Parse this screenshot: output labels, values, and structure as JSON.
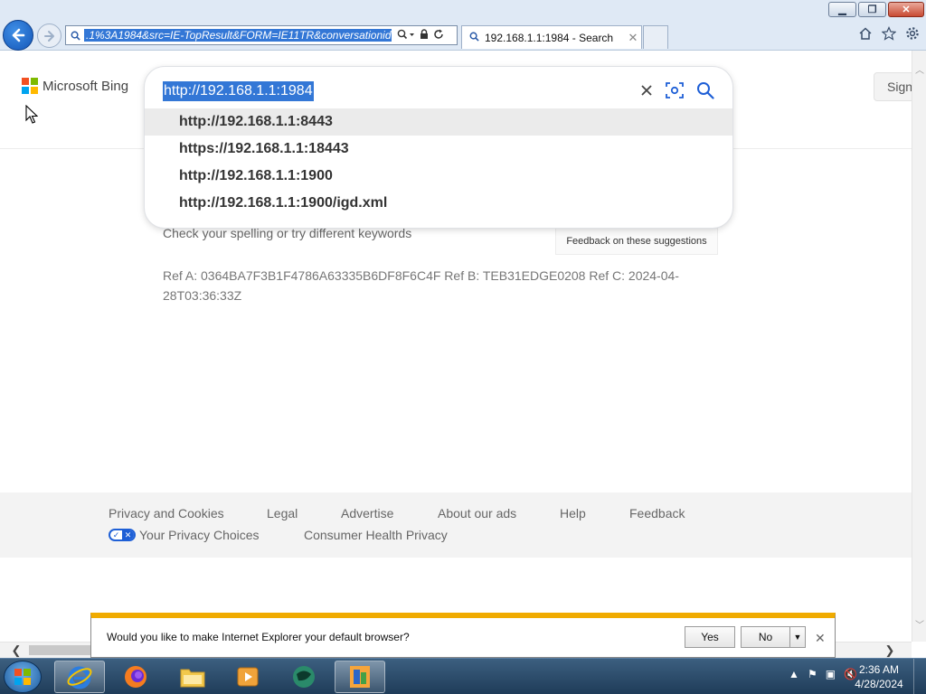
{
  "browser": {
    "address_url": ".1%3A1984&src=IE-TopResult&FORM=IE11TR&conversationid=",
    "tab_title": "192.168.1.1:1984 - Search"
  },
  "bing": {
    "logo_text": "Microsoft Bing",
    "signin_label": "Sign",
    "query": "http://192.168.1.1:1984",
    "suggestions": [
      "http://192.168.1.1:8443",
      "https://192.168.1.1:18443",
      "http://192.168.1.1:1900",
      "http://192.168.1.1:1900/igd.xml"
    ],
    "spell_tip": "Check your spelling or try different keywords",
    "feedback_suggestions": "Feedback on these suggestions",
    "ref_line": "Ref A: 0364BA7F3B1F4786A63335B6DF8F6C4F Ref B: TEB31EDGE0208 Ref C: 2024-04-28T03:36:33Z"
  },
  "footer": {
    "links": [
      "Privacy and Cookies",
      "Legal",
      "Advertise",
      "About our ads",
      "Help",
      "Feedback"
    ],
    "privacy_choices": "Your Privacy Choices",
    "consumer_health": "Consumer Health Privacy"
  },
  "notification": {
    "message": "Would you like to make Internet Explorer your default browser?",
    "yes_label": "Yes",
    "no_label": "No"
  },
  "taskbar": {
    "time": "2:36 AM",
    "date": "4/28/2024"
  },
  "colors": {
    "selection": "#3377d6",
    "notify_accent": "#f0ab00",
    "ms_red": "#f25022",
    "ms_green": "#7fba00",
    "ms_blue": "#00a4ef",
    "ms_yellow": "#ffb900"
  }
}
